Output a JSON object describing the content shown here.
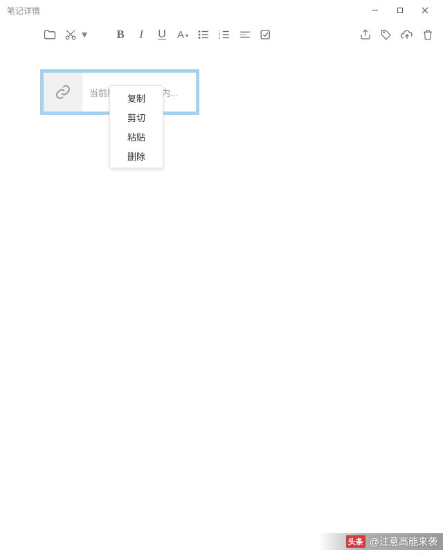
{
  "window": {
    "title": "笔记详情"
  },
  "toolbar": {
    "bold_label": "B",
    "italic_label": "I",
    "underline_label": "U",
    "font_label": "A"
  },
  "link_block": {
    "text": "当前版本不支持该内..."
  },
  "context_menu": {
    "items": [
      "复制",
      "剪切",
      "粘贴",
      "删除"
    ]
  },
  "watermark": {
    "logo": "头条",
    "text": "@注意高能来袭"
  }
}
